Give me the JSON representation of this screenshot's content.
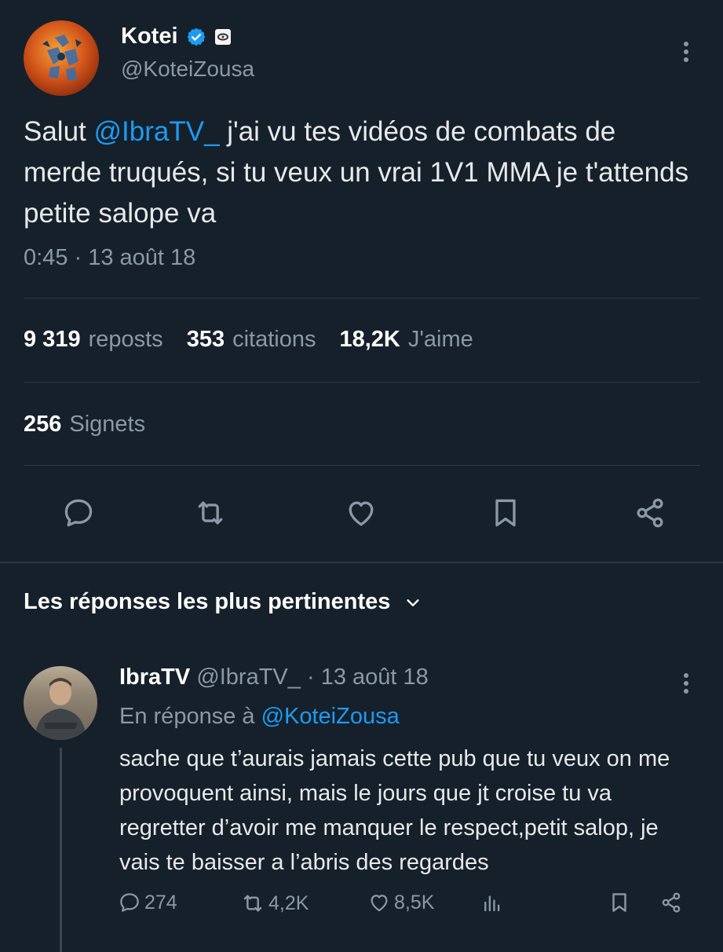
{
  "tweet": {
    "author_name": "Kotei",
    "author_handle": "@KoteiZousa",
    "text_prefix": "Salut ",
    "mention": "@IbraTV_",
    "text_suffix": " j'ai vu tes vidéos de combats de merde truqués, si tu veux un vrai 1V1 MMA je t'attends petite salope va",
    "timestamp": "0:45 · 13 août 18",
    "icons": {
      "verified": "verified-badge-icon",
      "affiliate": "affiliate-badge-icon",
      "more": "more-vertical-icon"
    }
  },
  "stats": {
    "reposts_count": "9 319",
    "reposts_label": "reposts",
    "quotes_count": "353",
    "quotes_label": "citations",
    "likes_count": "18,2K",
    "likes_label": "J'aime",
    "bookmarks_count": "256",
    "bookmarks_label": "Signets"
  },
  "actions": [
    "reply-icon",
    "repost-icon",
    "like-icon",
    "bookmark-icon",
    "share-icon"
  ],
  "replies_section": {
    "sort_label": "Les réponses les plus pertinentes"
  },
  "reply": {
    "author_name": "IbraTV",
    "author_handle": "@IbraTV_",
    "date": "· 13 août 18",
    "in_reply_to_label": "En réponse à",
    "in_reply_to_handle": "@KoteiZousa",
    "text": "sache que t’aurais jamais cette pub que tu veux on me provoquent ainsi, mais le jours que jt croise tu va regretter d’avoir me manquer le respect,petit salop, je vais te baisser a l’abris des regardes",
    "replies_count": "274",
    "reposts_count": "4,2K",
    "likes_count": "8,5K"
  },
  "colors": {
    "background": "#15202b",
    "accent": "#1d9bf0",
    "muted": "#8b98a5",
    "text": "#e7e9ea"
  }
}
